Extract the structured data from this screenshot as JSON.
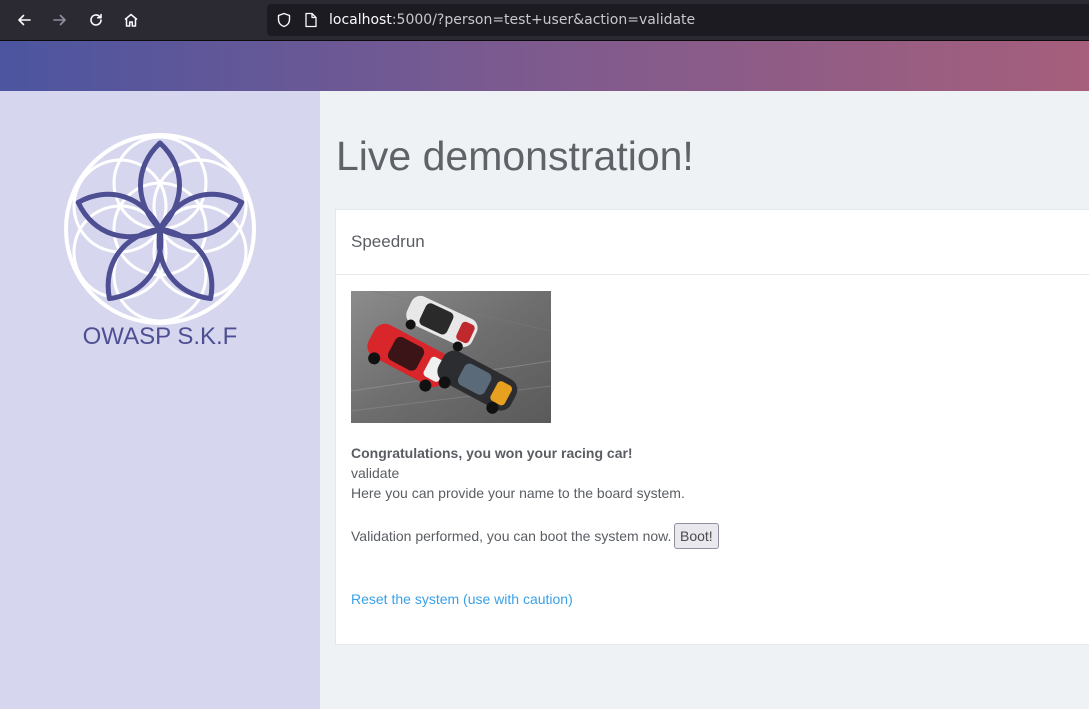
{
  "browser": {
    "url_host": "localhost",
    "url_rest": ":5000/?person=test+user&action=validate"
  },
  "sidebar": {
    "brand": "OWASP S.K.F"
  },
  "main": {
    "title": "Live demonstration!",
    "card": {
      "header": "Speedrun",
      "message_title": "Congratulations, you won your racing car!",
      "action_value": "validate",
      "info_text": "Here you can provide your name to the board system.",
      "validation_text": "Validation performed, you can boot the system now.",
      "boot_button": "Boot!",
      "reset_link": "Reset the system (use with caution)"
    }
  },
  "colors": {
    "brand": "#4e4f93",
    "link": "#3aa0e8",
    "sidebar_bg": "#d6d7ee"
  }
}
